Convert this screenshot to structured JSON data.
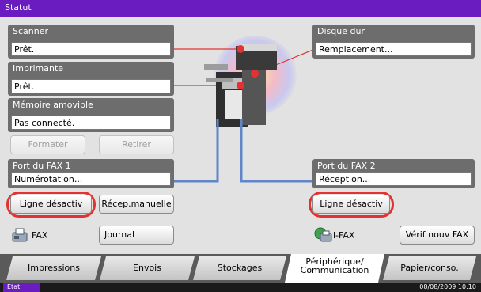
{
  "title": "Statut",
  "scanner": {
    "label": "Scanner",
    "status": "Prêt."
  },
  "printer": {
    "label": "Imprimante",
    "status": "Prêt."
  },
  "memory": {
    "label": "Mémoire amovible",
    "status": "Pas connecté.",
    "format_label": "Formater",
    "remove_label": "Retirer"
  },
  "harddisk": {
    "label": "Disque dur",
    "status": "Remplacement..."
  },
  "fax1": {
    "label": "Port du FAX 1",
    "status": "Numérotation...",
    "line_off_label": "Ligne désactiv",
    "manual_receive_label": "Récep.manuelle"
  },
  "fax2": {
    "label": "Port du FAX 2",
    "status": "Réception...",
    "line_off_label": "Ligne désactiv"
  },
  "fax": {
    "label": "FAX",
    "journal_label": "Journal"
  },
  "ifax": {
    "label": "i-FAX",
    "verify_label": "Vérif nouv FAX"
  },
  "tabs": [
    {
      "label": "Impressions"
    },
    {
      "label": "Envois"
    },
    {
      "label": "Stockages"
    },
    {
      "label": "Périphérique/ Communication"
    },
    {
      "label": "Papier/conso."
    }
  ],
  "status_bar": {
    "state_label": "État",
    "datetime": "08/08/2009  10:10"
  },
  "colors": {
    "title_bar": "#6a1cc0",
    "panel": "#6d6d6d",
    "highlight_ring": "#e23333",
    "cable": "#5f86c8"
  }
}
